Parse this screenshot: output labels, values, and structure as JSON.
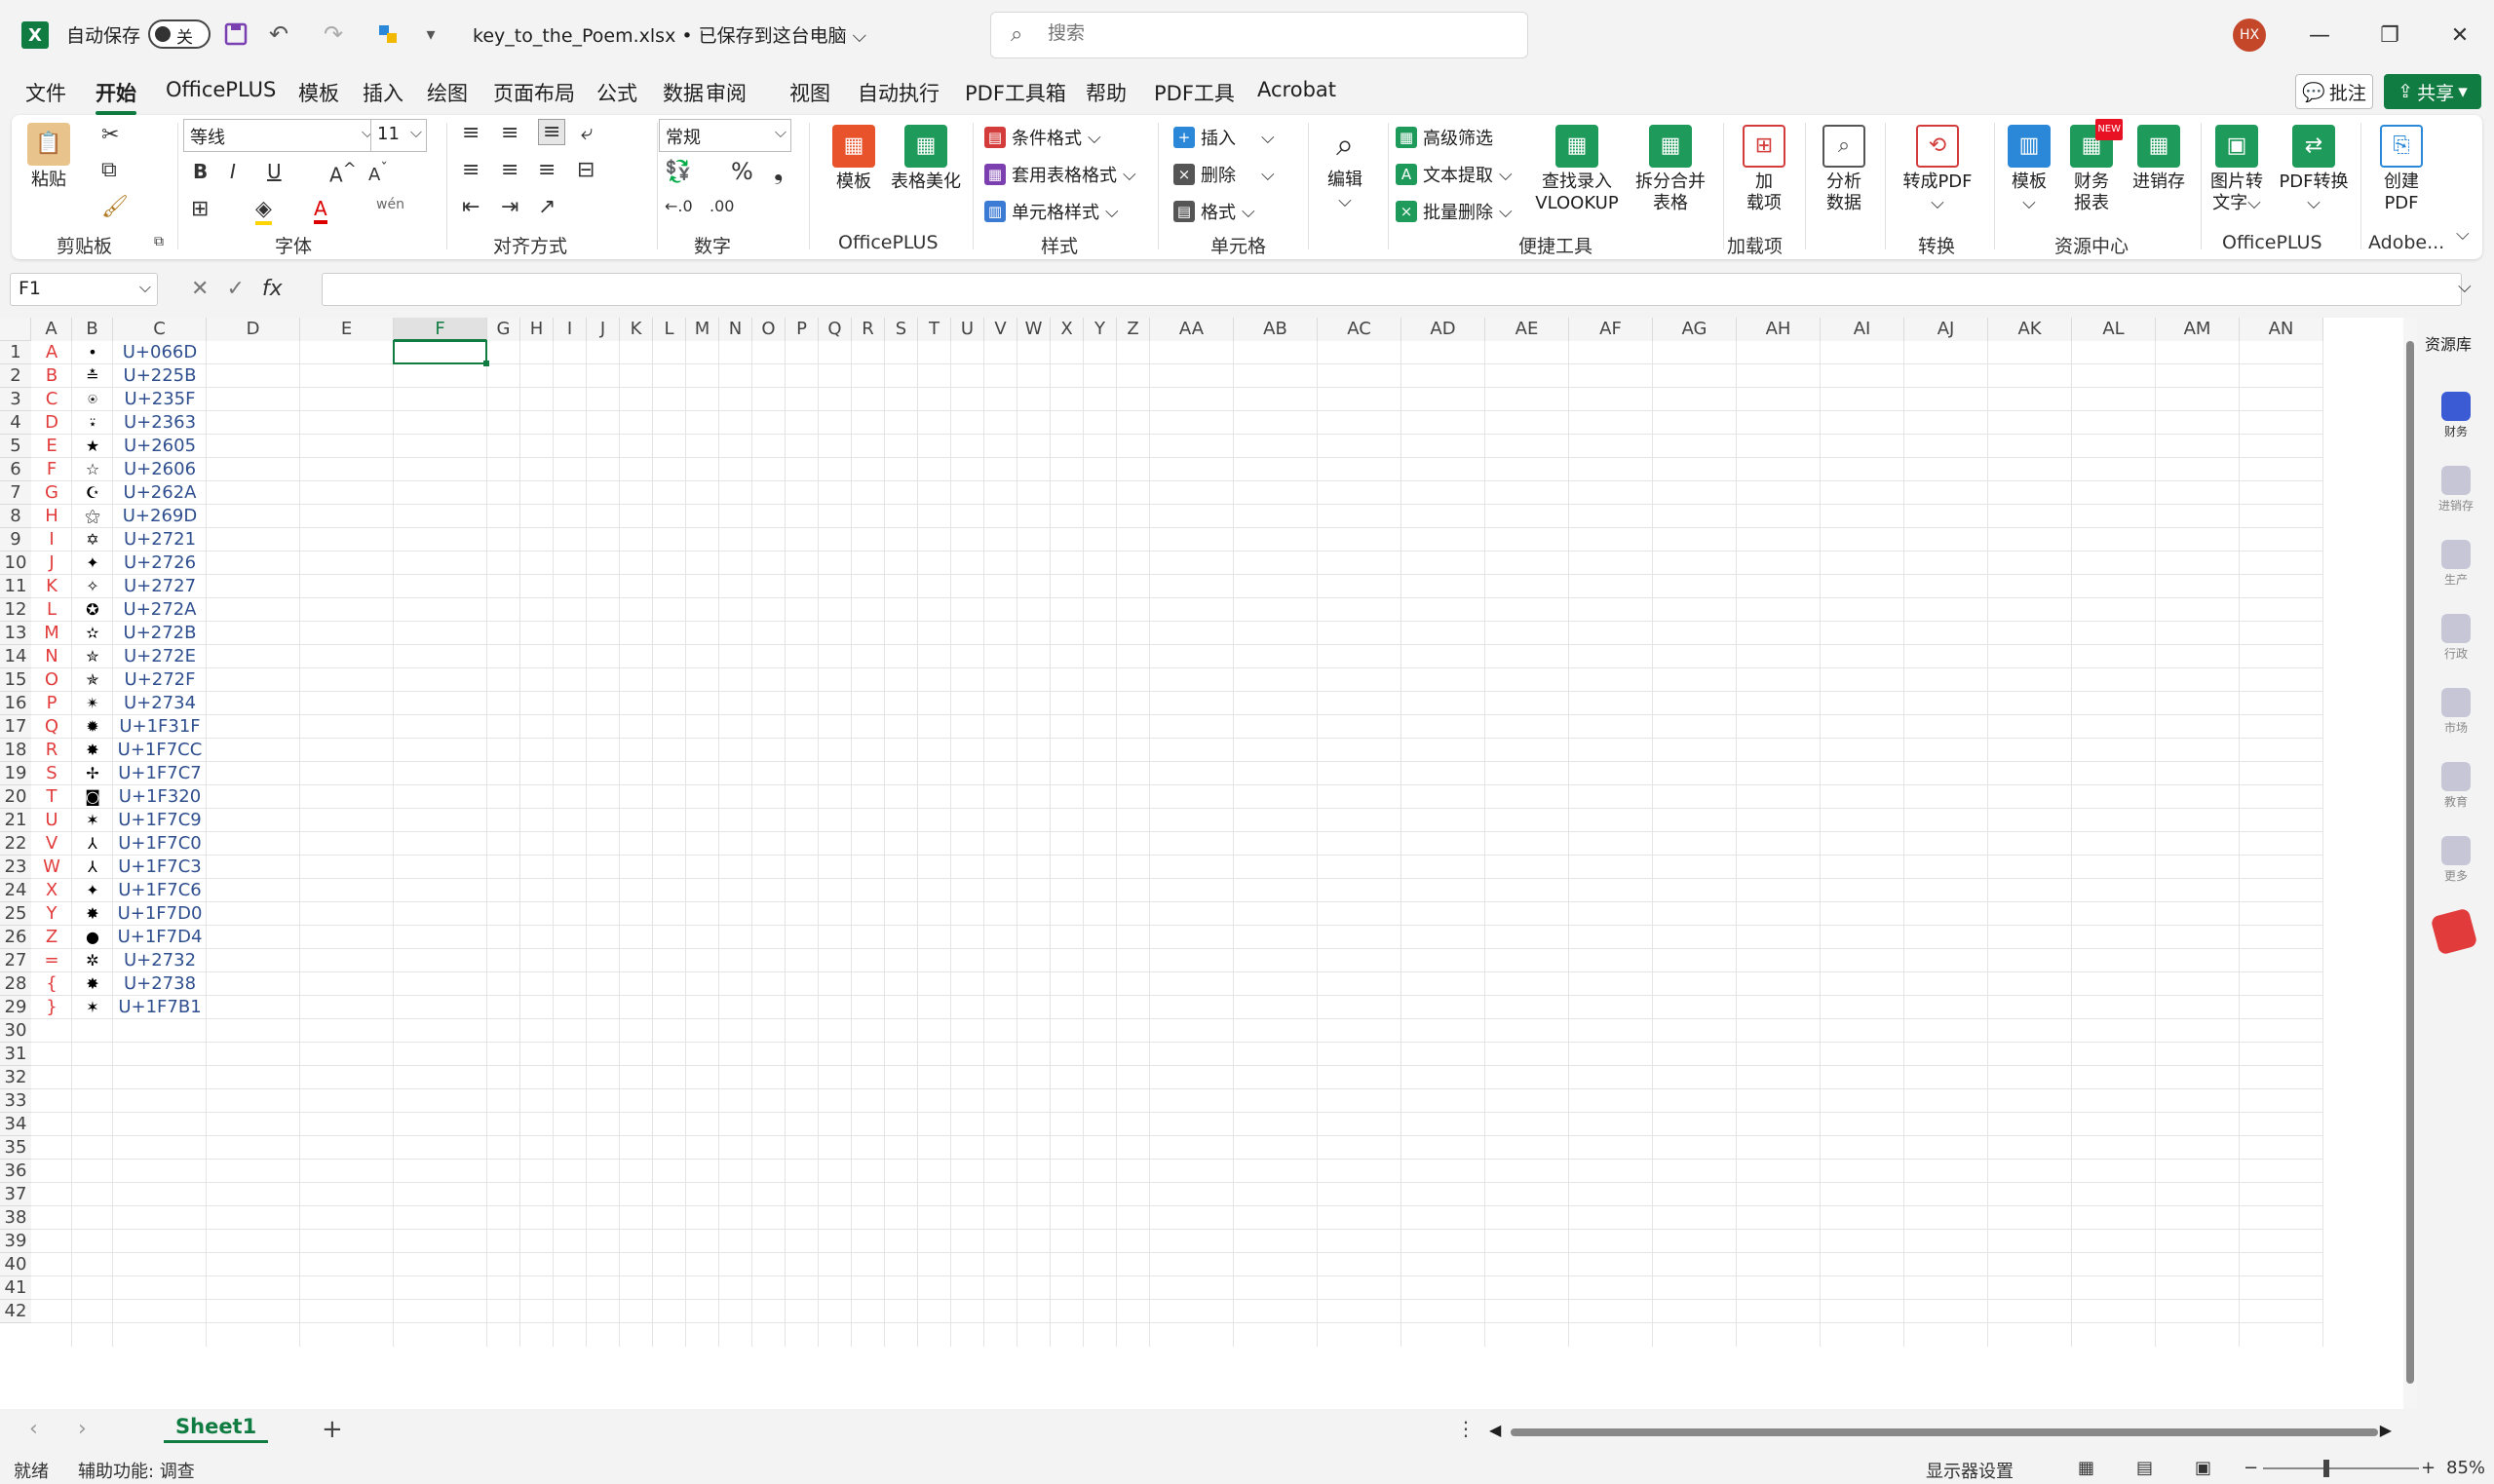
{
  "titlebar": {
    "autosave_label": "自动保存",
    "autosave_state": "关",
    "filename": "key_to_the_Poem.xlsx • 已保存到这台电脑 ⌵",
    "search_placeholder": "搜索",
    "user_initials": "HX"
  },
  "menu": {
    "tabs": [
      "文件",
      "开始",
      "OfficePLUS",
      "模板",
      "插入",
      "绘图",
      "页面布局",
      "公式",
      "数据",
      "审阅",
      "视图",
      "自动执行",
      "PDF工具箱",
      "帮助",
      "PDF工具",
      "Acrobat"
    ],
    "active": "开始",
    "comment_label": "批注",
    "share_label": "共享"
  },
  "ribbon": {
    "clipboard": {
      "paste": "粘贴",
      "group": "剪贴板"
    },
    "font": {
      "name": "等线",
      "size": "11",
      "group": "字体"
    },
    "align": {
      "group": "对齐方式"
    },
    "number": {
      "format": "常规",
      "group": "数字"
    },
    "officeplus": {
      "template": "模板",
      "beautify": "表格美化",
      "group": "OfficePLUS"
    },
    "styles": {
      "cond": "条件格式",
      "table": "套用表格格式",
      "cell": "单元格样式",
      "group": "样式"
    },
    "cells": {
      "insert": "插入",
      "delete": "删除",
      "format": "格式",
      "group": "单元格"
    },
    "edit": {
      "label": "编辑"
    },
    "tools": {
      "filter": "高级筛选",
      "extract": "文本提取",
      "batchdel": "批量删除",
      "vlookup_1": "查找录入",
      "vlookup_2": "VLOOKUP",
      "split_1": "拆分合并",
      "split_2": "表格",
      "group": "便捷工具"
    },
    "addins": {
      "l1": "加",
      "l2": "载项",
      "group": "加载项"
    },
    "analyze": {
      "l1": "分析",
      "l2": "数据"
    },
    "convert": {
      "topdf": "转成PDF",
      "group": "转换"
    },
    "resources": {
      "template": "模板",
      "fin_1": "财务",
      "fin_2": "报表",
      "inv": "进销存",
      "group": "资源中心",
      "new_badge": "NEW"
    },
    "officeplus2": {
      "img_1": "图片转",
      "img_2": "文字",
      "pdf": "PDF转换",
      "group": "OfficePLUS"
    },
    "adobe": {
      "l1": "创建",
      "l2": "PDF",
      "group": "Adobe..."
    }
  },
  "formulabar": {
    "namebox": "F1",
    "fx": "fx"
  },
  "grid": {
    "columns": [
      "A",
      "B",
      "C",
      "D",
      "E",
      "F",
      "G",
      "H",
      "I",
      "J",
      "K",
      "L",
      "M",
      "N",
      "O",
      "P",
      "Q",
      "R",
      "S",
      "T",
      "U",
      "V",
      "W",
      "X",
      "Y",
      "Z",
      "AA",
      "AB",
      "AC",
      "AD",
      "AE",
      "AF",
      "AG",
      "AH",
      "AI",
      "AJ",
      "AK",
      "AL",
      "AM",
      "AN"
    ],
    "selected_col": "F",
    "rows": [
      {
        "a": "A",
        "b": "•",
        "c": "U+066D"
      },
      {
        "a": "B",
        "b": "≛",
        "c": "U+225B"
      },
      {
        "a": "C",
        "b": "⍟",
        "c": "U+235F"
      },
      {
        "a": "D",
        "b": "⍣",
        "c": "U+2363"
      },
      {
        "a": "E",
        "b": "★",
        "c": "U+2605"
      },
      {
        "a": "F",
        "b": "☆",
        "c": "U+2606"
      },
      {
        "a": "G",
        "b": "☪",
        "c": "U+262A"
      },
      {
        "a": "H",
        "b": "⚝",
        "c": "U+269D"
      },
      {
        "a": "I",
        "b": "✡",
        "c": "U+2721"
      },
      {
        "a": "J",
        "b": "✦",
        "c": "U+2726"
      },
      {
        "a": "K",
        "b": "✧",
        "c": "U+2727"
      },
      {
        "a": "L",
        "b": "✪",
        "c": "U+272A"
      },
      {
        "a": "M",
        "b": "✫",
        "c": "U+272B"
      },
      {
        "a": "N",
        "b": "✮",
        "c": "U+272E"
      },
      {
        "a": "O",
        "b": "✯",
        "c": "U+272F"
      },
      {
        "a": "P",
        "b": "✴",
        "c": "U+2734"
      },
      {
        "a": "Q",
        "b": "✹",
        "c": "U+1F31F"
      },
      {
        "a": "R",
        "b": "✸",
        "c": "U+1F7CC"
      },
      {
        "a": "S",
        "b": "✢",
        "c": "U+1F7C7"
      },
      {
        "a": "T",
        "b": "◙",
        "c": "U+1F320"
      },
      {
        "a": "U",
        "b": "✶",
        "c": "U+1F7C9"
      },
      {
        "a": "V",
        "b": "⅄",
        "c": "U+1F7C0"
      },
      {
        "a": "W",
        "b": "⅄",
        "c": "U+1F7C3"
      },
      {
        "a": "X",
        "b": "✦",
        "c": "U+1F7C6"
      },
      {
        "a": "Y",
        "b": "✸",
        "c": "U+1F7D0"
      },
      {
        "a": "Z",
        "b": "●",
        "c": "U+1F7D4"
      },
      {
        "a": "=",
        "b": "✲",
        "c": "U+2732"
      },
      {
        "a": "{",
        "b": "✸",
        "c": "U+2738"
      },
      {
        "a": "}",
        "b": "✶",
        "c": "U+1F7B1"
      }
    ],
    "row_count": 42
  },
  "rightpane": {
    "title": "资源库",
    "items": [
      "财务",
      "进销存",
      "生产",
      "行政",
      "市场",
      "教育",
      "更多"
    ]
  },
  "sheets": {
    "active": "Sheet1",
    "add": "+"
  },
  "status": {
    "ready": "就绪",
    "accessibility": "辅助功能: 调查",
    "display": "显示器设置",
    "zoom": "85%"
  },
  "colors": {
    "accent": "#107c41",
    "letters": "#e23b3b",
    "codes": "#2f4f8f"
  }
}
